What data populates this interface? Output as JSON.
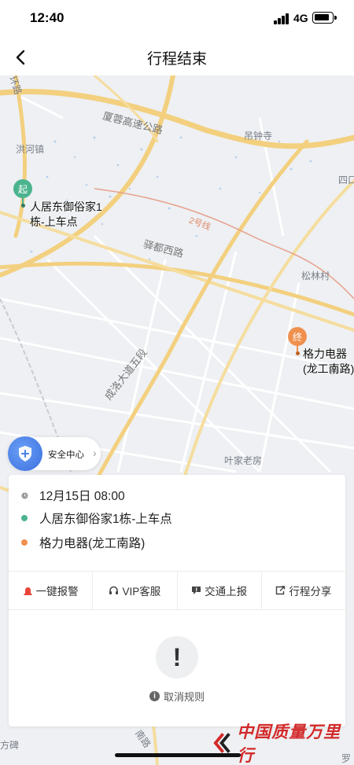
{
  "status_bar": {
    "time": "12:40",
    "network": "4G"
  },
  "nav": {
    "title": "行程结束",
    "back_icon": "chevron-left-icon"
  },
  "map": {
    "labels": {
      "highway": "厦蓉高速公路",
      "hongzhen": "洪河镇",
      "diaozhong": "吊钟寺",
      "sijia": "四口",
      "line2": "2号线",
      "yidu": "驿都西路",
      "songlin": "松林村",
      "ave5": "成洛大道五段",
      "yejia": "叶家老房",
      "fangbei": "方碑",
      "luo": "罗",
      "ring": "环路",
      "south_road": "南路",
      "zhen": "镇"
    },
    "start_pin": {
      "char": "起",
      "label": "人居东御俗家1栋-上车点",
      "color": "#4cb38f"
    },
    "end_pin": {
      "char": "终",
      "label": "格力电器(龙工南路)",
      "color": "#f0904f"
    }
  },
  "safety": {
    "label": "安全中心"
  },
  "trip": {
    "time": "12月15日 08:00",
    "start": "人居东御俗家1栋-上车点",
    "end": "格力电器(龙工南路)",
    "start_color": "#4cb38f",
    "end_color": "#f0904f"
  },
  "actions": [
    {
      "label": "一键报警",
      "icon": "alarm-icon"
    },
    {
      "label": "VIP客服",
      "icon": "headset-icon"
    },
    {
      "label": "交通上报",
      "icon": "report-icon"
    },
    {
      "label": "行程分享",
      "icon": "share-icon"
    }
  ],
  "cancel": {
    "label": "取消规则",
    "alert": "!"
  },
  "watermark": {
    "text": "中国质量万里行"
  }
}
